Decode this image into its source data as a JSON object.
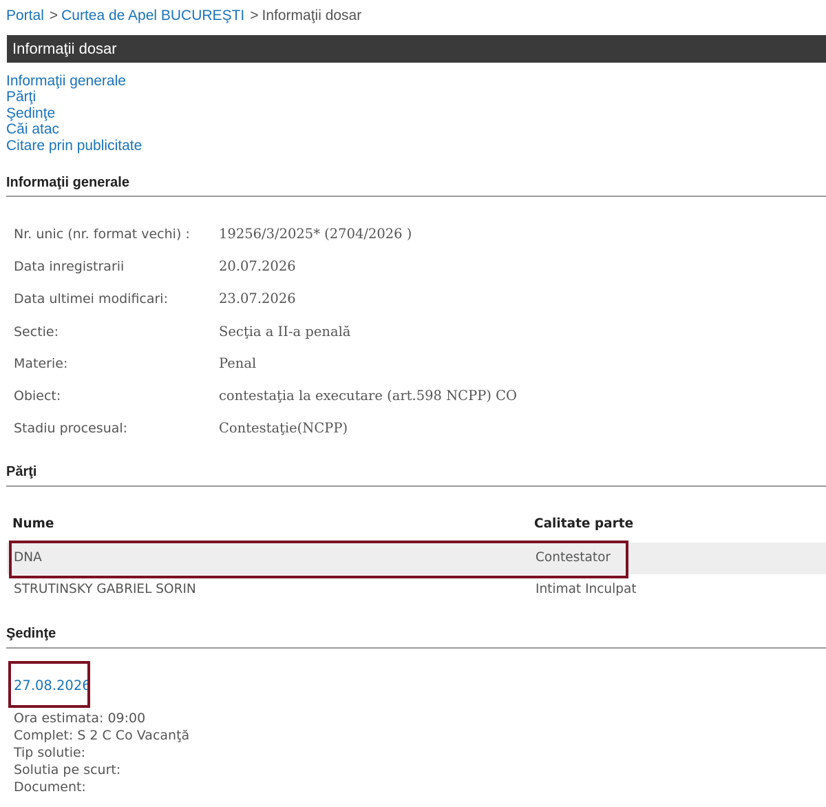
{
  "breadcrumb": {
    "portal": "Portal",
    "court": "Curtea de Apel BUCUREŞTI",
    "current": "Informaţii dosar",
    "separator": ">"
  },
  "title_bar": "Informaţii dosar",
  "anchors": [
    "Informaţii generale",
    "Părţi",
    "Şedinţe",
    "Căi atac",
    "Citare prin publicitate"
  ],
  "general": {
    "heading": "Informaţii generale",
    "rows": [
      {
        "label": "Nr. unic (nr. format vechi) :",
        "value": "19256/3/2025* (2704/2026 )"
      },
      {
        "label": "Data inregistrarii",
        "value": "20.07.2026"
      },
      {
        "label": "Data ultimei modificari:",
        "value": "23.07.2026"
      },
      {
        "label": "Sectie:",
        "value": "Secţia a II-a penală"
      },
      {
        "label": "Materie:",
        "value": "Penal"
      },
      {
        "label": "Obiect:",
        "value": "contestaţia la executare (art.598 NCPP) CO"
      },
      {
        "label": "Stadiu procesual:",
        "value": "Contestaţie(NCPP)"
      }
    ]
  },
  "parties": {
    "heading": "Părţi",
    "columns": [
      "Nume",
      "Calitate parte"
    ],
    "rows": [
      {
        "name": "DNA",
        "role": "Contestator"
      },
      {
        "name": "STRUTINSKY GABRIEL SORIN",
        "role": "Intimat Inculpat"
      }
    ]
  },
  "hearings": {
    "heading": "Şedinţe",
    "date": "27.08.2026",
    "details": [
      "Ora estimata: 09:00",
      "Complet: S 2 C Co Vacanţă",
      "Tip solutie:",
      "Solutia pe scurt:",
      "Document:"
    ]
  },
  "colors": {
    "link": "#1a73b8",
    "title_bar_bg": "#3a3a3a",
    "highlight_border": "#7a1122",
    "row_shade": "#eeeeee"
  }
}
